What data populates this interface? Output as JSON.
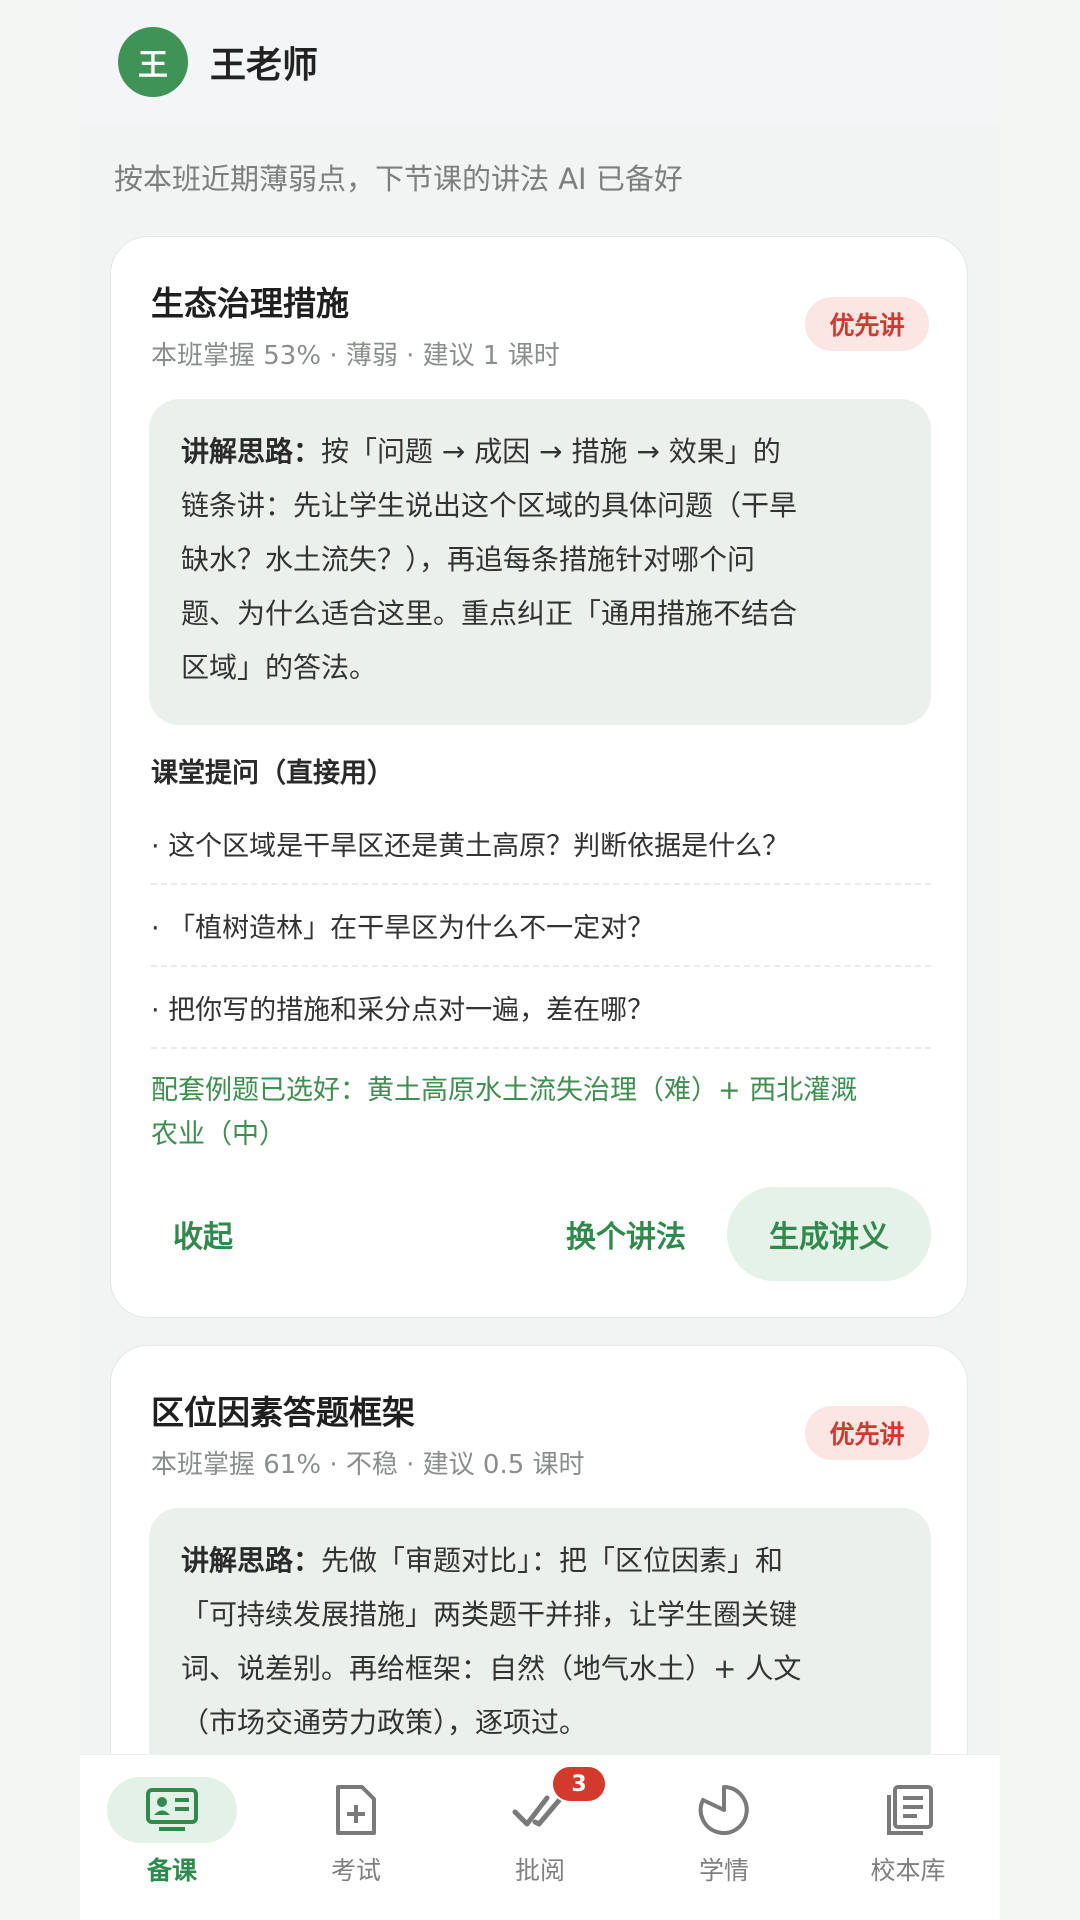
{
  "header": {
    "avatar_initial": "王",
    "teacher_name": "王老师"
  },
  "subtitle": "按本班近期薄弱点，下节课的讲法 AI 已备好",
  "cards": [
    {
      "title": "生态治理措施",
      "meta": "本班掌握 53% · 薄弱 · 建议 1 课时",
      "priority": "优先讲",
      "approach_label": "讲解思路：",
      "approach_lines": [
        "按「问题 → 成因 → 措施 → 效果」的",
        "链条讲：先让学生说出这个区域的具体问题（干旱",
        "缺水？水土流失？），再追每条措施针对哪个问",
        "题、为什么适合这里。重点纠正「通用措施不结合",
        "区域」的答法。"
      ],
      "questions_label": "课堂提问（直接用）",
      "questions": [
        "· 这个区域是干旱区还是黄土高原？判断依据是什么？",
        "· 「植树造林」在干旱区为什么不一定对？",
        "· 把你写的措施和采分点对一遍，差在哪？"
      ],
      "examples_lines": [
        "配套例题已选好：黄土高原水土流失治理（难）+ 西北灌溉",
        "农业（中）"
      ],
      "collapse_label": "收起",
      "change_label": "换个讲法",
      "generate_label": "生成讲义"
    },
    {
      "title": "区位因素答题框架",
      "meta": "本班掌握 61% · 不稳 · 建议 0.5 课时",
      "priority": "优先讲",
      "approach_label": "讲解思路：",
      "approach_lines": [
        "先做「审题对比」：把「区位因素」和",
        "「可持续发展措施」两类题干并排，让学生圈关键",
        "词、说差别。再给框架：自然（地气水土）+ 人文",
        "（市场交通劳力政策），逐项过。"
      ]
    }
  ],
  "tabs": [
    {
      "label": "备课",
      "icon": "lesson-prep-icon",
      "active": true
    },
    {
      "label": "考试",
      "icon": "exam-add-icon"
    },
    {
      "label": "批阅",
      "icon": "grading-check-icon",
      "badge": "3"
    },
    {
      "label": "学情",
      "icon": "analytics-pie-icon"
    },
    {
      "label": "校本库",
      "icon": "library-doc-icon"
    }
  ],
  "colors": {
    "accent": "#2f8a4c",
    "avatar": "#3f9357",
    "priority_text": "#cf3a2e",
    "priority_bg": "#fbe6e4"
  }
}
